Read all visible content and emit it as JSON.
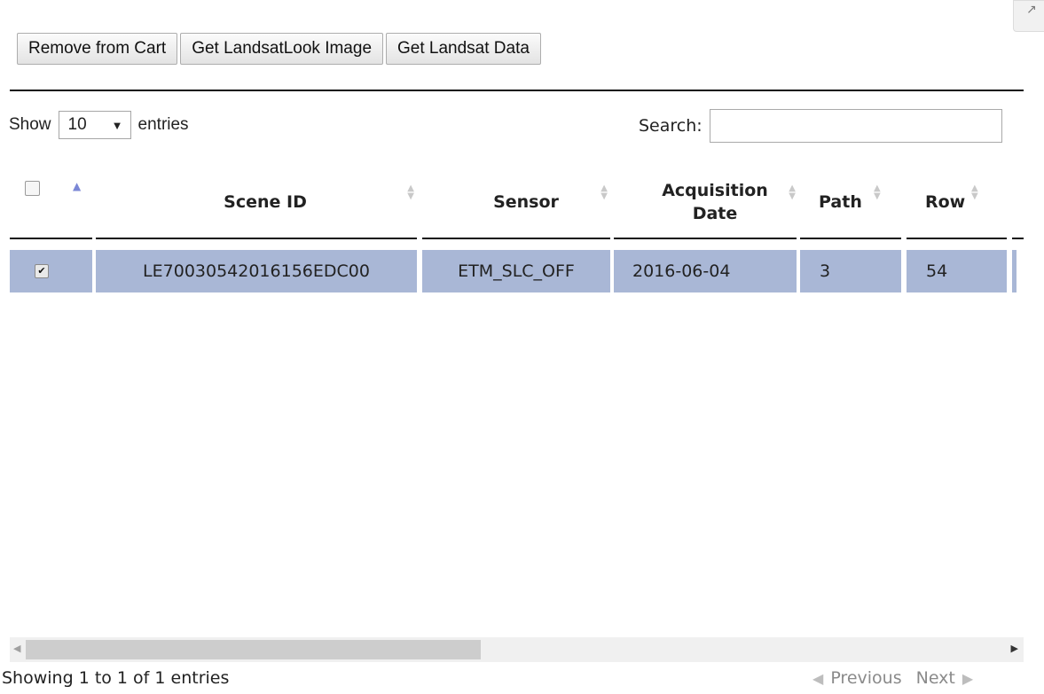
{
  "toolbar": {
    "remove_label": "Remove from Cart",
    "look_label": "Get LandsatLook Image",
    "data_label": "Get Landsat Data"
  },
  "length": {
    "prefix": "Show",
    "value": "10",
    "suffix": "entries"
  },
  "search": {
    "label": "Search:",
    "value": ""
  },
  "table": {
    "headers": [
      "Scene ID",
      "Sensor",
      "Acquisition Date",
      "Path",
      "Row"
    ],
    "headers_split": {
      "acq_line1": "Acquisition",
      "acq_line2": "Date"
    },
    "sort_column": "checkbox",
    "sort_direction": "ascending",
    "rows": [
      {
        "selected": true,
        "scene_id": "LE70030542016156EDC00",
        "sensor": "ETM_SLC_OFF",
        "acquisition_date": "2016-06-04",
        "path": "3",
        "row": "54"
      }
    ],
    "selected_row_color": "#a9b7d6",
    "sort_active_color": "#7b87d6"
  },
  "footer": {
    "info": "Showing 1 to 1 of 1 entries",
    "previous": "Previous",
    "next": "Next"
  },
  "icons": {
    "corner": "expand-icon",
    "select_arrow": "chevron-down-icon"
  }
}
